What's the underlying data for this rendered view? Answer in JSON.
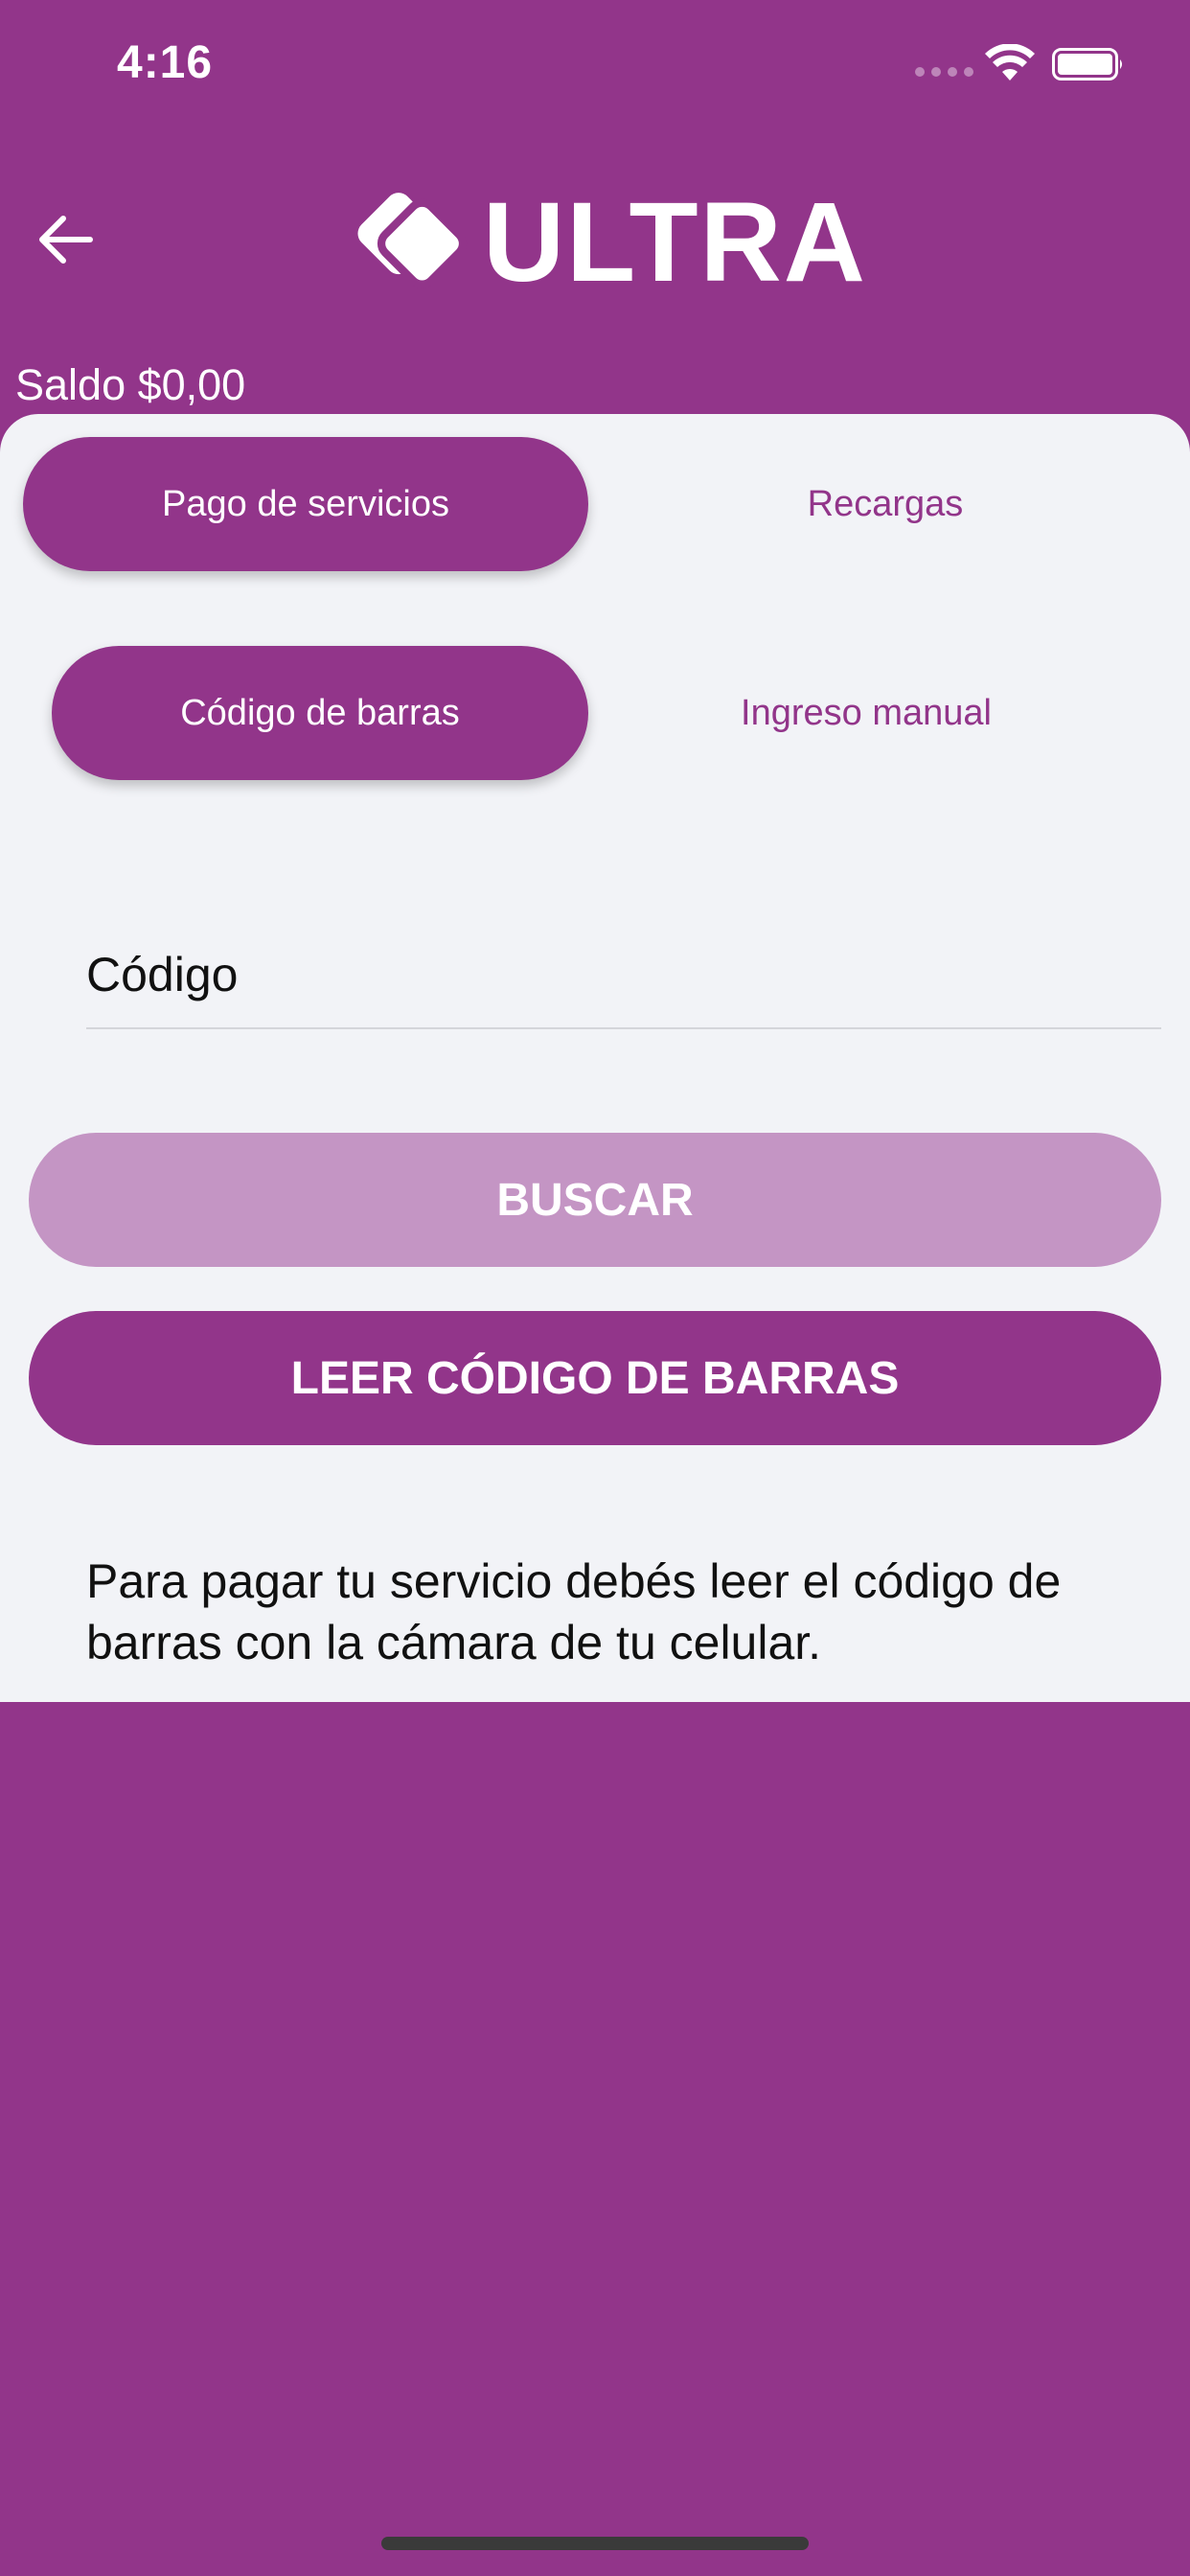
{
  "status_bar": {
    "time": "4:16"
  },
  "header": {
    "logo_text": "ULTRA",
    "balance": "Saldo $0,00"
  },
  "tabs": [
    {
      "label": "Pago de servicios",
      "active": true
    },
    {
      "label": "Recargas",
      "active": false
    }
  ],
  "subtabs": [
    {
      "label": "Código de barras",
      "active": true
    },
    {
      "label": "Ingreso manual",
      "active": false
    }
  ],
  "form": {
    "code_label": "Código"
  },
  "buttons": {
    "search": "BUSCAR",
    "scan": "LEER CÓDIGO DE BARRAS"
  },
  "info_text": "Para pagar tu servicio debés leer el código de barras con la cámara de tu celular.",
  "colors": {
    "brand": "#92358A",
    "brand_disabled": "#C495C4",
    "card": "#F2F3F7"
  }
}
